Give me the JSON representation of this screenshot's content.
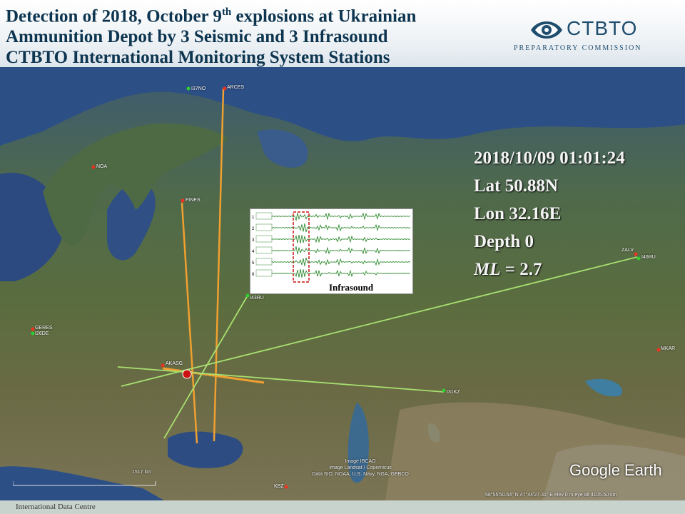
{
  "header": {
    "title_line1_a": "Detection of 2018, October 9",
    "title_line1_sup": "th",
    "title_line1_b": " explosions at Ukrainian",
    "title_line2": "Ammunition Depot by 3 Seismic and 3 Infrasound",
    "title_line3": "CTBTO International Monitoring System Stations",
    "logo_name": "CTBTO",
    "logo_subtitle": "PREPARATORY COMMISSION",
    "logo_icon": "ctbto-eye-logo"
  },
  "event": {
    "datetime": "2018/10/09 01:01:24",
    "lat": "Lat 50.88N",
    "lon": "Lon 32.16E",
    "depth": "Depth 0",
    "ml_label": "ML",
    "ml_value": " = 2.7"
  },
  "inset": {
    "label": "Infrasound",
    "channel_numbers": [
      "1",
      "2",
      "3",
      "4",
      "5",
      "6"
    ]
  },
  "stations": {
    "s1": "I37NO",
    "s2": "ARCES",
    "s3": "NOA",
    "s4": "FINES",
    "s5": "I43RU",
    "s6": "GERES",
    "s7": "I26DE",
    "s8": "AKASG",
    "s9": "ZALV",
    "s10": "I46RU",
    "s11": "I31KZ",
    "s12": "MKAR",
    "s13": "KBZ"
  },
  "map": {
    "scale_label": "1517 km",
    "credit_line1": "Image IBCAO",
    "credit_line2": "Image Landsat / Copernicus",
    "credit_line3": "Data SIO, NOAA, U.S. Navy, NGA, GEBCO",
    "coordinates": "58°55'50.64\" N   47°44'27.31\" E   elev   0 m   eye alt 4105.50 km",
    "brand": "Google Earth"
  },
  "footer": {
    "text": "International Data Centre"
  },
  "colors": {
    "seismic_line": "#f0a030",
    "infrasound_line": "#a8e070",
    "event_marker": "#cc1111",
    "title": "#0d3550"
  }
}
